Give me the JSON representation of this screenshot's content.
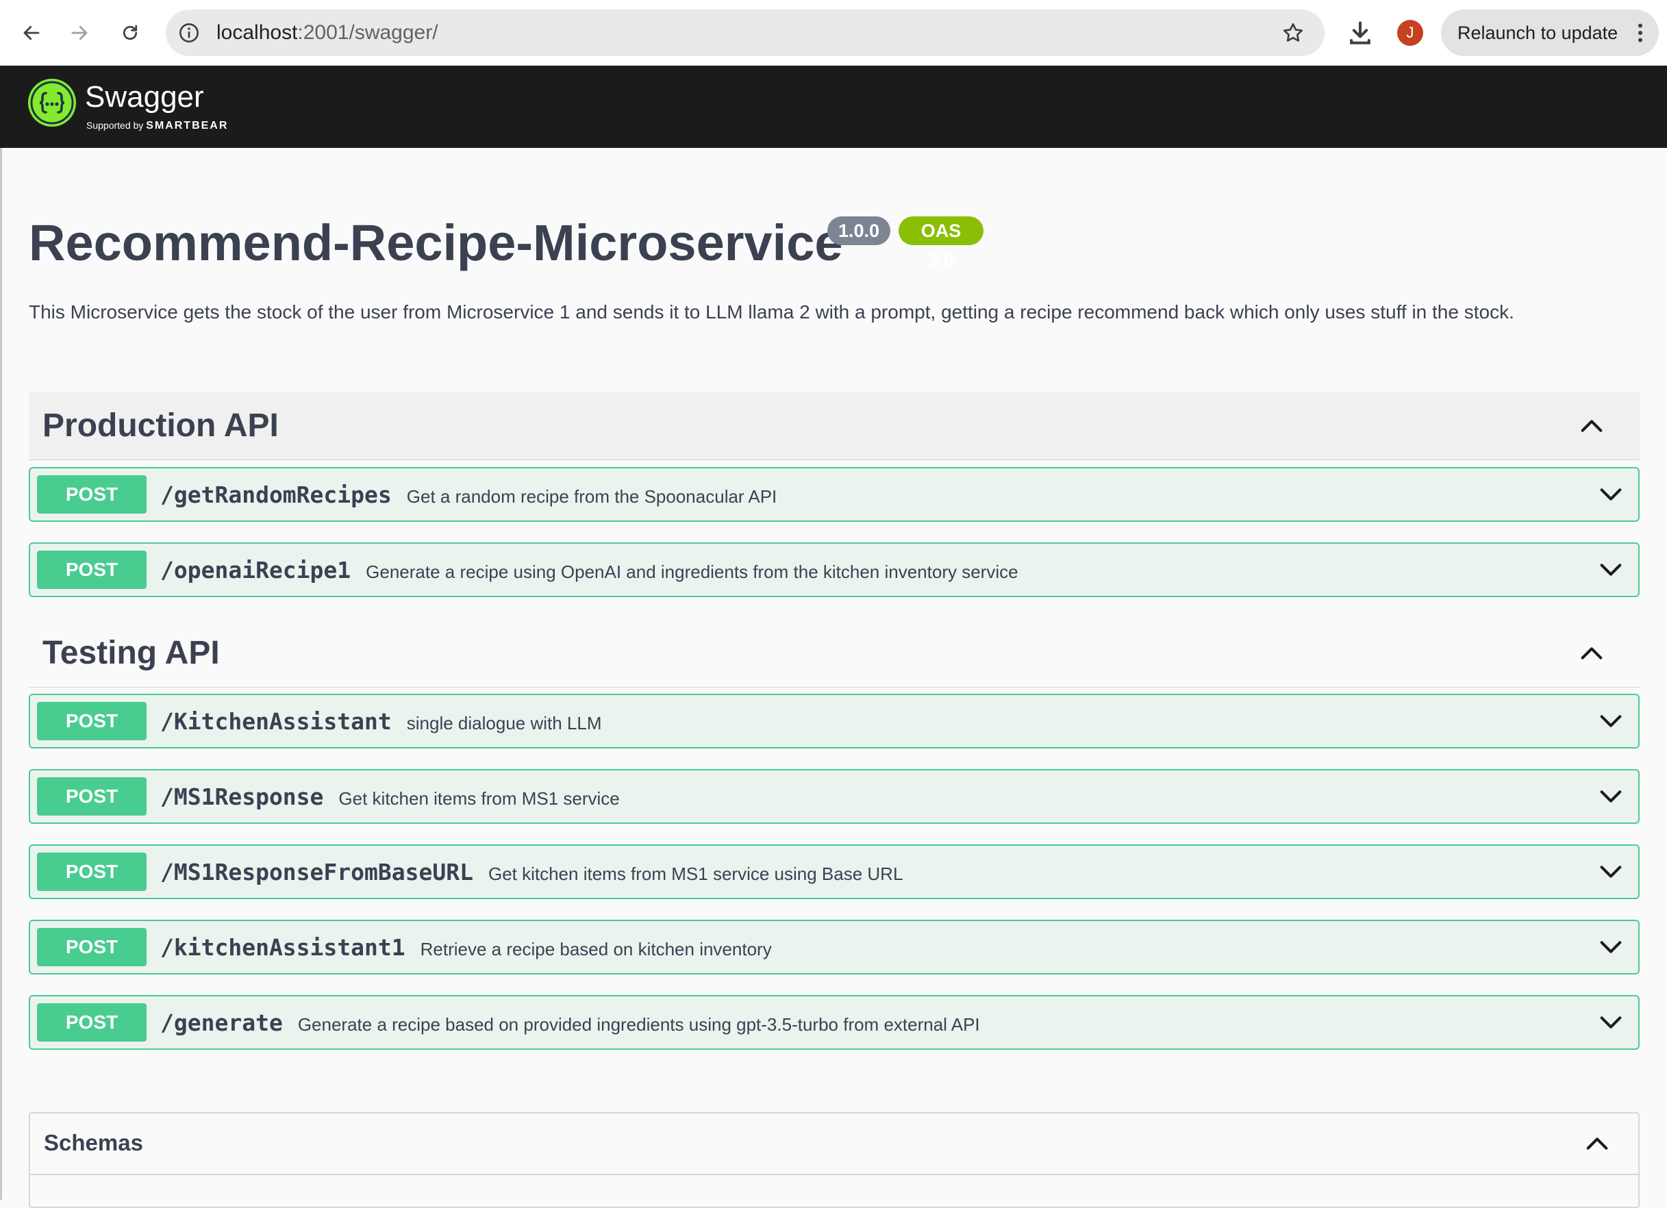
{
  "browser": {
    "url_host": "localhost",
    "url_path": ":2001/swagger/",
    "profile_initial": "J",
    "relaunch_label": "Relaunch to update",
    "icons": [
      "back-icon",
      "forward-icon",
      "reload-icon",
      "site-info-icon",
      "bookmark-star-icon",
      "download-icon",
      "menu-dots-icon"
    ]
  },
  "topbar": {
    "logo_text": "Swagger",
    "supported_by": "Supported by",
    "supported_brand": "SMARTBEAR"
  },
  "info": {
    "title": "Recommend-Recipe-Microservice",
    "version": "1.0.0",
    "oas": "OAS 3.0",
    "description": "This Microservice gets the stock of the user from Microservice 1 and sends it to LLM llama 2 with a prompt, getting a recipe recommend back which only uses stuff in the stock."
  },
  "tags": [
    {
      "name": "Production API",
      "operations": [
        {
          "method": "POST",
          "path": "/getRandomRecipes",
          "summary": "Get a random recipe from the Spoonacular API"
        },
        {
          "method": "POST",
          "path": "/openaiRecipe1",
          "summary": "Generate a recipe using OpenAI and ingredients from the kitchen inventory service"
        }
      ]
    },
    {
      "name": "Testing API",
      "operations": [
        {
          "method": "POST",
          "path": "/KitchenAssistant",
          "summary": "single dialogue with LLM"
        },
        {
          "method": "POST",
          "path": "/MS1Response",
          "summary": "Get kitchen items from MS1 service"
        },
        {
          "method": "POST",
          "path": "/MS1ResponseFromBaseURL",
          "summary": "Get kitchen items from MS1 service using Base URL"
        },
        {
          "method": "POST",
          "path": "/kitchenAssistant1",
          "summary": "Retrieve a recipe based on kitchen inventory"
        },
        {
          "method": "POST",
          "path": "/generate",
          "summary": "Generate a recipe based on provided ingredients using gpt-3.5-turbo from external API"
        }
      ]
    }
  ],
  "schemas": {
    "title": "Schemas"
  },
  "colors": {
    "post_border": "#49cc90",
    "post_bg": "#ebf3ef",
    "topbar_bg": "#1b1b1b",
    "logo_green": "#85ea2d",
    "version_badge": "#7d8492",
    "oas_badge": "#89bf04"
  }
}
